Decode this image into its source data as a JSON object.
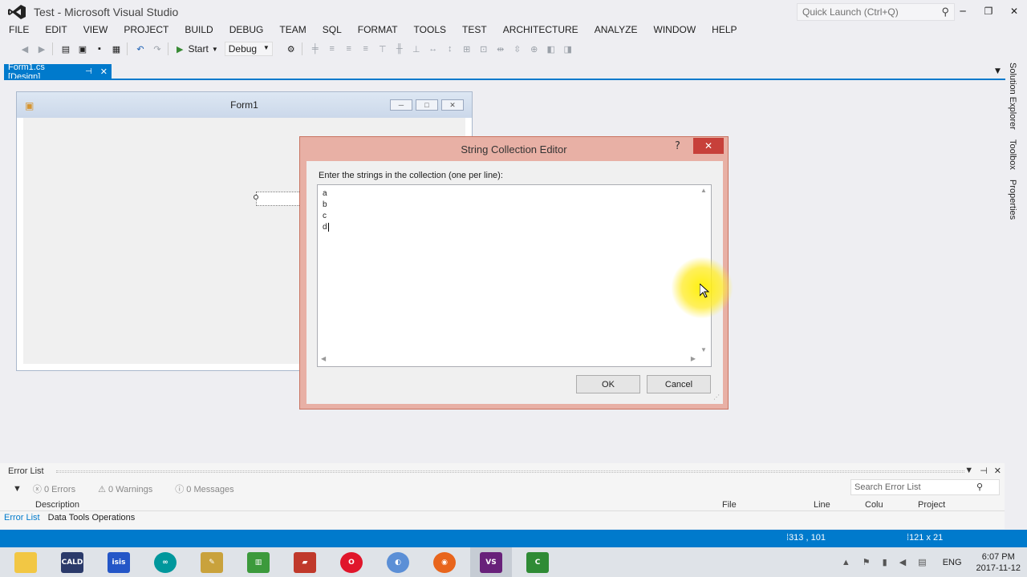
{
  "window": {
    "title": "Test - Microsoft Visual Studio",
    "quick_launch": "Quick Launch (Ctrl+Q)"
  },
  "menu": [
    "FILE",
    "EDIT",
    "VIEW",
    "PROJECT",
    "BUILD",
    "DEBUG",
    "TEAM",
    "SQL",
    "FORMAT",
    "TOOLS",
    "TEST",
    "ARCHITECTURE",
    "ANALYZE",
    "WINDOW",
    "HELP"
  ],
  "toolbar": {
    "start_label": "Start",
    "config_value": "Debug"
  },
  "doc_tab": {
    "label": "Form1.cs [Design]"
  },
  "side_panels": [
    "Solution Explorer",
    "Toolbox",
    "Properties"
  ],
  "form": {
    "title": "Form1"
  },
  "dialog": {
    "title": "String Collection Editor",
    "help": "?",
    "prompt": "Enter the strings in the collection (one per line):",
    "lines": [
      "a",
      "b",
      "c",
      "d"
    ],
    "ok_label": "OK",
    "cancel_label": "Cancel"
  },
  "error_list": {
    "title": "Error List",
    "errors": "0 Errors",
    "warnings": "0 Warnings",
    "messages": "0 Messages",
    "search_placeholder": "Search Error List",
    "columns": [
      "Description",
      "File",
      "Line",
      "Colu",
      "Project"
    ],
    "tabs": [
      "Error List",
      "Data Tools Operations"
    ]
  },
  "status": {
    "position": "313 , 101",
    "size": "121 x 21"
  },
  "taskbar": {
    "apps": [
      "file-explorer",
      "caldi",
      "isis",
      "arduino",
      "tool",
      "spreadsheet",
      "book",
      "opera",
      "browser",
      "firefox",
      "visual-studio",
      "codeblocks"
    ],
    "language": "ENG",
    "time": "6:07 PM",
    "date": "2017-11-12"
  }
}
